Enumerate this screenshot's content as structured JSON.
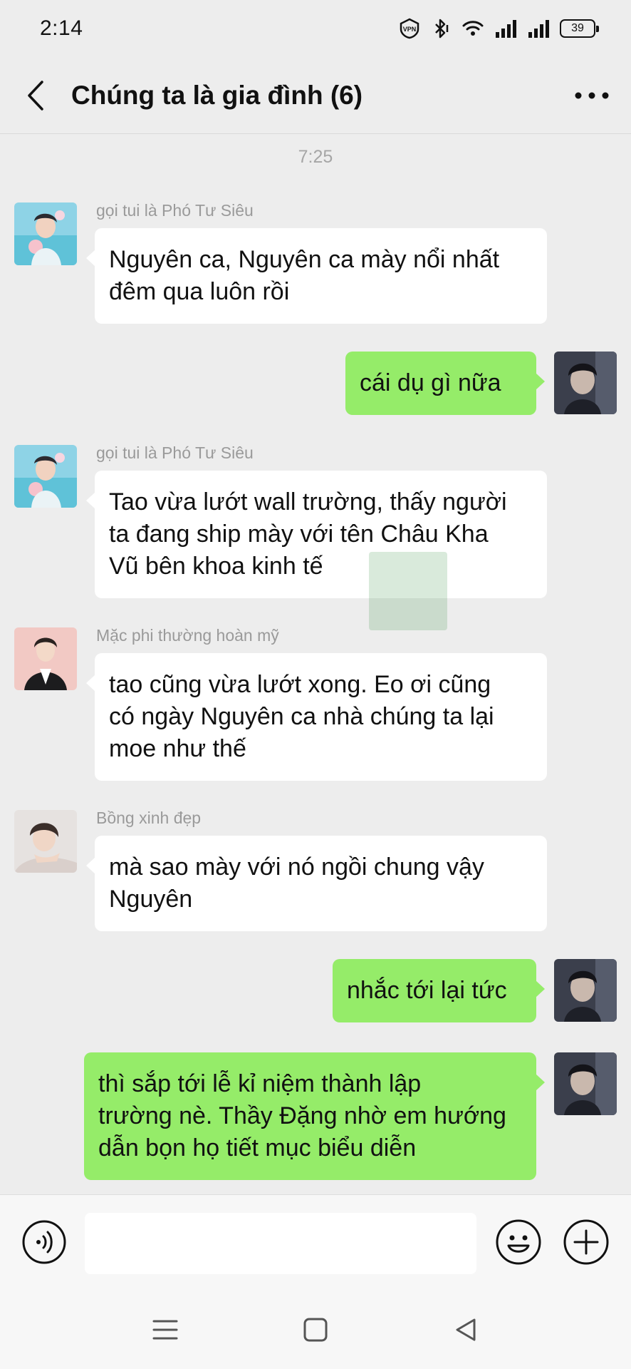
{
  "status_bar": {
    "time": "2:14",
    "battery": "39",
    "icons": [
      "vpn-icon",
      "bluetooth-icon",
      "wifi-icon",
      "signal-icon",
      "signal-icon",
      "battery-icon"
    ]
  },
  "header": {
    "title": "Chúng ta là gia đình (6)",
    "back_icon": "chevron-left-icon",
    "more_icon": "more-horizontal-icon"
  },
  "chat": {
    "time_divider": "7:25",
    "messages": [
      {
        "side": "left",
        "sender": "gọi tui là Phó Tư Siêu",
        "text": "Nguyên ca, Nguyên ca mày nổi nhất\nđêm qua luôn rồi"
      },
      {
        "side": "right",
        "text": "cái dụ gì nữa"
      },
      {
        "side": "left",
        "sender": "gọi tui là Phó Tư Siêu",
        "text": "Tao vừa lướt wall trường, thấy người\nta đang ship mày với tên Châu Kha\nVũ bên khoa kinh tế"
      },
      {
        "side": "left",
        "sender": "Mặc phi thường hoàn mỹ",
        "text": "tao cũng vừa lướt xong. Eo ơi cũng\ncó ngày Nguyên ca nhà chúng ta lại\nmoe như thế"
      },
      {
        "side": "left",
        "sender": "Bồng xinh đẹp",
        "text": "mà sao mày với nó ngồi chung vậy\nNguyên"
      },
      {
        "side": "right",
        "text": "nhắc tới lại tức"
      },
      {
        "side": "right",
        "text": "thì sắp tới lễ kỉ niệm thành lập\ntrường nè. Thầy Đặng nhờ em hướng\ndẫn bọn họ tiết mục biểu diễn"
      }
    ]
  },
  "input_bar": {
    "value": "",
    "voice_icon": "voice-icon",
    "emoji_icon": "emoji-icon",
    "plus_icon": "plus-circle-icon"
  },
  "nav_bar": {
    "icons": [
      "menu-icon",
      "home-square-icon",
      "back-triangle-icon"
    ]
  },
  "colors": {
    "background": "#ededed",
    "incoming_bubble": "#ffffff",
    "outgoing_bubble": "#95ec69",
    "sender_text": "#9a9a9a"
  }
}
